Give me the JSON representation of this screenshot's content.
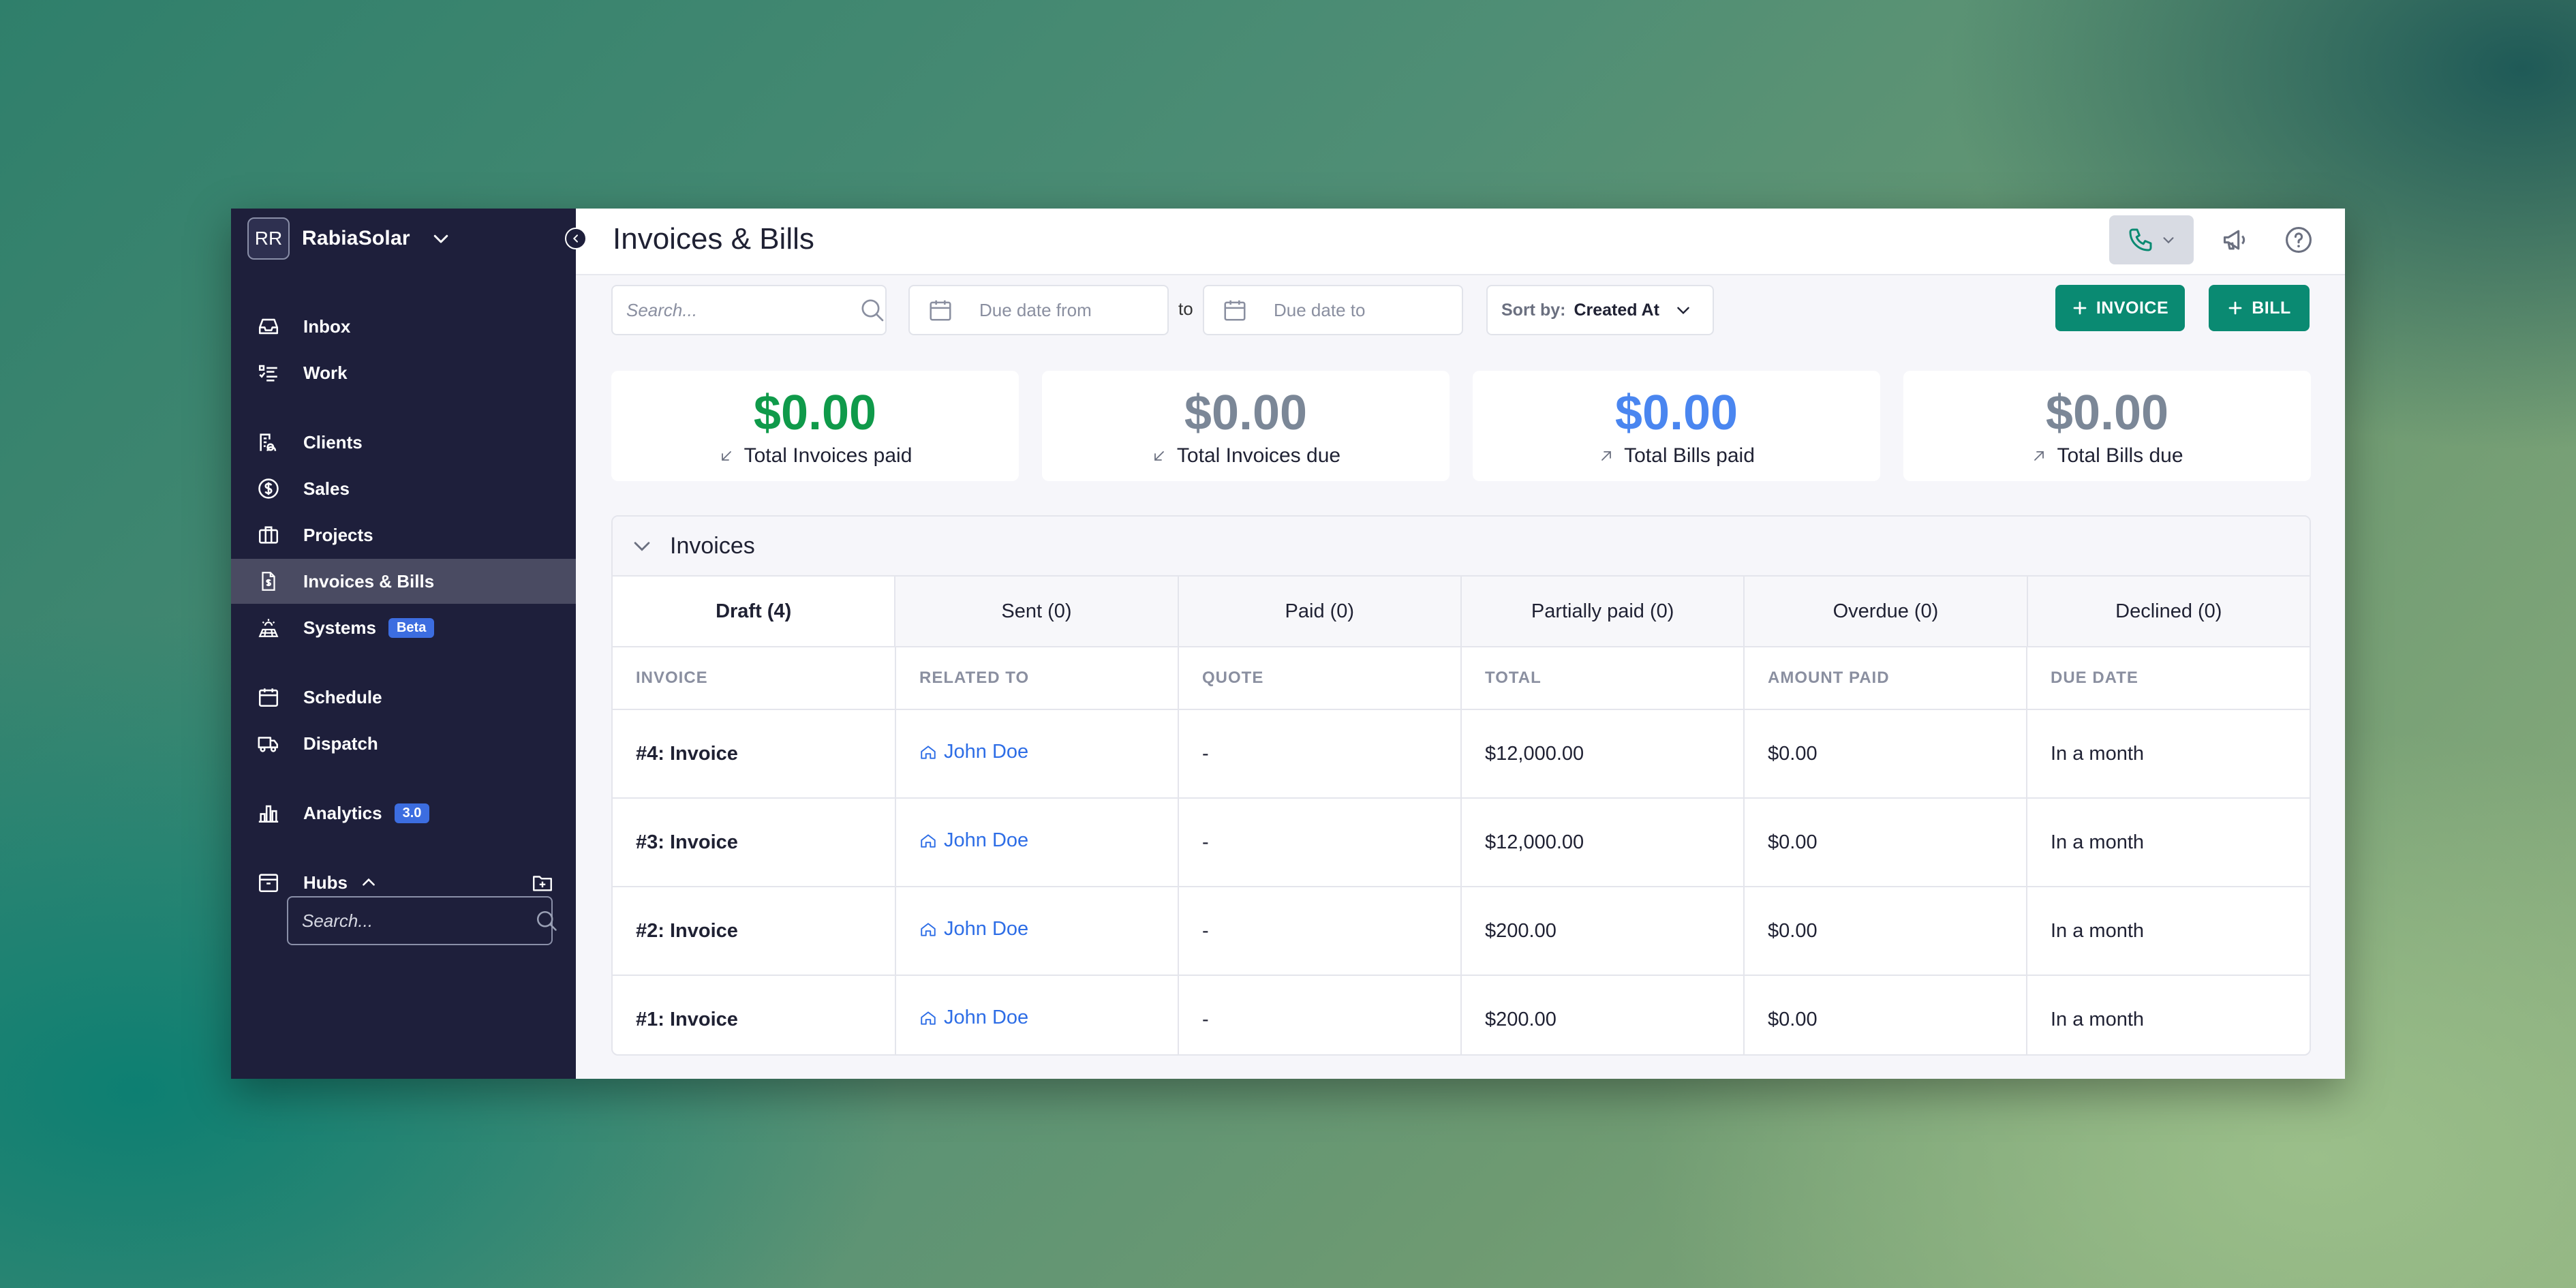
{
  "brand": {
    "initials": "RR",
    "name": "RabiaSolar"
  },
  "nav": {
    "inbox": "Inbox",
    "work": "Work",
    "clients": "Clients",
    "sales": "Sales",
    "projects": "Projects",
    "invoices": "Invoices & Bills",
    "systems": "Systems",
    "systems_badge": "Beta",
    "schedule": "Schedule",
    "dispatch": "Dispatch",
    "analytics": "Analytics",
    "analytics_badge": "3.0",
    "hubs": "Hubs",
    "hubs_search_placeholder": "Search..."
  },
  "header": {
    "title": "Invoices & Bills"
  },
  "toolbar": {
    "search_placeholder": "Search...",
    "due_from_placeholder": "Due date from",
    "to_label": "to",
    "due_to_placeholder": "Due date to",
    "sort_label": "Sort by:",
    "sort_value": "Created At",
    "invoice_button": "INVOICE",
    "bill_button": "BILL"
  },
  "stats": [
    {
      "value": "$0.00",
      "label": "Total Invoices paid",
      "color": "#0f9a4a"
    },
    {
      "value": "$0.00",
      "label": "Total Invoices due",
      "color": "#7b8797"
    },
    {
      "value": "$0.00",
      "label": "Total Bills paid",
      "color": "#4a86f0"
    },
    {
      "value": "$0.00",
      "label": "Total Bills due",
      "color": "#7b8797"
    }
  ],
  "invoices_panel": {
    "title": "Invoices",
    "tabs": [
      "Draft (4)",
      "Sent (0)",
      "Paid (0)",
      "Partially paid (0)",
      "Overdue (0)",
      "Declined (0)"
    ],
    "columns": [
      "INVOICE",
      "RELATED TO",
      "QUOTE",
      "TOTAL",
      "AMOUNT PAID",
      "DUE DATE"
    ],
    "rows": [
      {
        "invoice": "#4: Invoice",
        "related": "John Doe",
        "quote": "-",
        "total": "$12,000.00",
        "paid": "$0.00",
        "due": "In a month"
      },
      {
        "invoice": "#3: Invoice",
        "related": "John Doe",
        "quote": "-",
        "total": "$12,000.00",
        "paid": "$0.00",
        "due": "In a month"
      },
      {
        "invoice": "#2: Invoice",
        "related": "John Doe",
        "quote": "-",
        "total": "$200.00",
        "paid": "$0.00",
        "due": "In a month"
      },
      {
        "invoice": "#1: Invoice",
        "related": "John Doe",
        "quote": "-",
        "total": "$200.00",
        "paid": "$0.00",
        "due": "In a month"
      }
    ]
  },
  "colors": {
    "sidebar": "#1e1f3b",
    "accent": "#0a8a72",
    "link": "#2d6de6"
  }
}
